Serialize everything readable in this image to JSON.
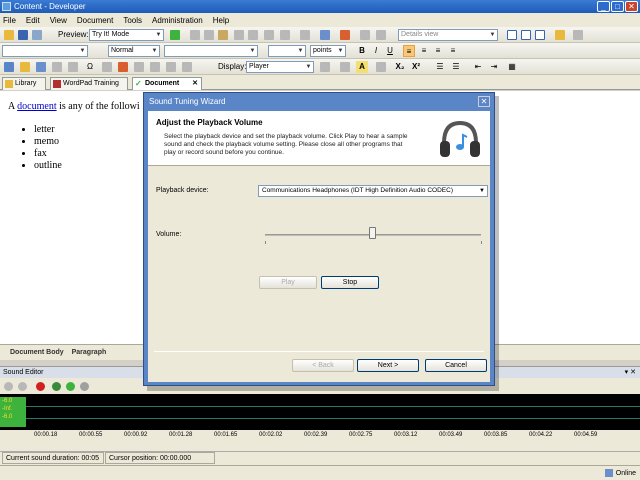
{
  "window": {
    "title": "Content - Developer",
    "min": "_",
    "max": "□",
    "close": "✕"
  },
  "menu": [
    "File",
    "Edit",
    "View",
    "Document",
    "Tools",
    "Administration",
    "Help"
  ],
  "toolbar1": {
    "preview_label": "Preview:",
    "preview_mode": "Try It! Mode",
    "view_select": "Details view"
  },
  "toolbar2": {
    "style": "Normal",
    "size_unit": "points",
    "bold": "B",
    "italic": "I",
    "underline": "U"
  },
  "toolbar3": {
    "display_label": "Display:",
    "display_value": "Player",
    "highlight": "A",
    "subscript": "X₂",
    "superscript": "X²"
  },
  "tabs": [
    {
      "label": "Library"
    },
    {
      "label": "WordPad Training"
    },
    {
      "label": "Document",
      "active": true
    }
  ],
  "document": {
    "intro_prefix": "A ",
    "link": "document",
    "intro_suffix": " is any of the followi",
    "items": [
      "letter",
      "memo",
      "fax",
      "outline"
    ]
  },
  "pathbar": [
    "Document Body",
    "Paragraph"
  ],
  "sound_editor": {
    "title": "Sound Editor",
    "pin": "▾ ✕",
    "meter": [
      "-6.0",
      "-Inf.",
      "-6.0"
    ],
    "times": [
      "00:00.18",
      "00:00.55",
      "00:00.92",
      "00:01.28",
      "00:01.65",
      "00:02.02",
      "00:02.39",
      "00:02.75",
      "00:03.12",
      "00:03.49",
      "00:03.85",
      "00:04.22",
      "00:04.59"
    ],
    "duration": "Current sound duration: 00:05",
    "cursor": "Cursor position: 00:00.000"
  },
  "status": {
    "online": "Online"
  },
  "dialog": {
    "title": "Sound Tuning Wizard",
    "close": "✕",
    "heading": "Adjust the Playback Volume",
    "description": "Select the playback device and set the playback volume. Click Play to hear a sample sound and check the playback volume setting. Please close all other programs that play or record sound before you continue.",
    "device_label": "Playback device:",
    "device_value": "Communications Headphones (IDT High Definition Audio CODEC)",
    "volume_label": "Volume:",
    "volume_level": 0.5,
    "play": "Play",
    "stop": "Stop",
    "back": "< Back",
    "next": "Next >",
    "cancel": "Cancel"
  },
  "colors": {
    "titlebar": "#1e5bb8",
    "dialog_frame": "#5a86c7",
    "meter": "#3db33d"
  }
}
